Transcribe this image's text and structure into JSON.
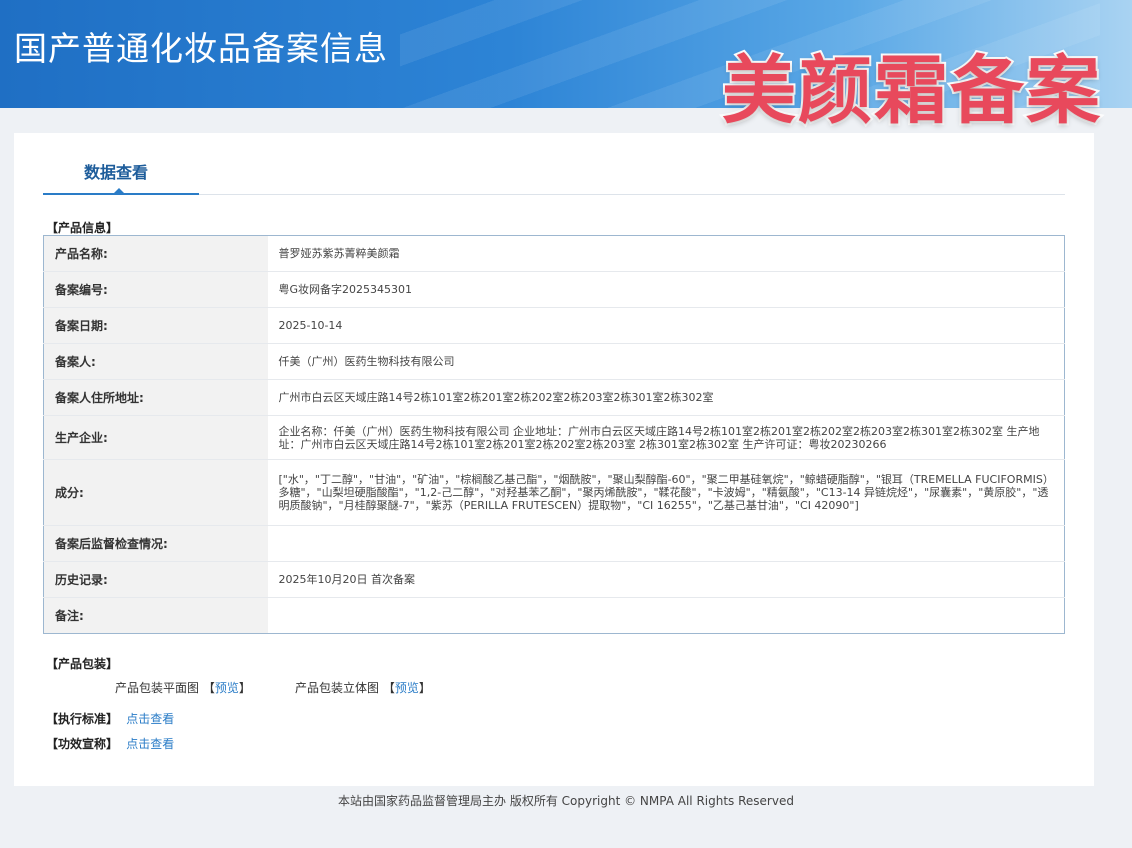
{
  "header": {
    "site_title": "国产普通化妆品备案信息",
    "stamp_text": "美颜霜备案"
  },
  "tab": {
    "label": "数据查看"
  },
  "product_info": {
    "section_title": "【产品信息】",
    "rows": [
      {
        "label": "产品名称:",
        "value": "普罗娅苏紫苏菁粹美颜霜"
      },
      {
        "label": "备案编号:",
        "value": "粤G妆网备字2025345301"
      },
      {
        "label": "备案日期:",
        "value": "2025-10-14"
      },
      {
        "label": "备案人:",
        "value": "仟美（广州）医药生物科技有限公司"
      },
      {
        "label": "备案人住所地址:",
        "value": "广州市白云区天域庄路14号2栋101室2栋201室2栋202室2栋203室2栋301室2栋302室"
      },
      {
        "label": "生产企业:",
        "value": "企业名称：仟美（广州）医药生物科技有限公司 企业地址：广州市白云区天域庄路14号2栋101室2栋201室2栋202室2栋203室2栋301室2栋302室 生产地址：广州市白云区天域庄路14号2栋101室2栋201室2栋202室2栋203室 2栋301室2栋302室 生产许可证：粤妆20230266"
      },
      {
        "label": "成分:",
        "value": "[\"水\"，\"丁二醇\"，\"甘油\"，\"矿油\"，\"棕榈酸乙基己酯\"，\"烟酰胺\"，\"聚山梨醇酯-60\"，\"聚二甲基硅氧烷\"，\"鲸蜡硬脂醇\"，\"银耳（TREMELLA FUCIFORMIS）多糖\"，\"山梨坦硬脂酸酯\"，\"1,2-己二醇\"，\"对羟基苯乙酮\"，\"聚丙烯酰胺\"，\"鞣花酸\"，\"卡波姆\"，\"精氨酸\"，\"C13-14 异链烷烃\"，\"尿囊素\"，\"黄原胶\"，\"透明质酸钠\"，\"月桂醇聚醚-7\"，\"紫苏（PERILLA FRUTESCEN）提取物\"，\"CI 16255\"，\"乙基己基甘油\"，\"CI 42090\"]"
      },
      {
        "label": "备案后监督检查情况:",
        "value": ""
      },
      {
        "label": "历史记录:",
        "value": "2025年10月20日 首次备案"
      },
      {
        "label": "备注:",
        "value": ""
      }
    ]
  },
  "packaging": {
    "section_title": "【产品包装】",
    "flat_label": "产品包装平面图",
    "solid_label": "产品包装立体图",
    "bracket_open": "【",
    "bracket_close": "】",
    "preview_link": "预览"
  },
  "standard": {
    "label": "【执行标准】",
    "link": "点击查看"
  },
  "efficacy": {
    "label": "【功效宣称】",
    "link": "点击查看"
  },
  "footer": {
    "text": "本站由国家药品监督管理局主办 版权所有 Copyright © NMPA All Rights Reserved"
  }
}
